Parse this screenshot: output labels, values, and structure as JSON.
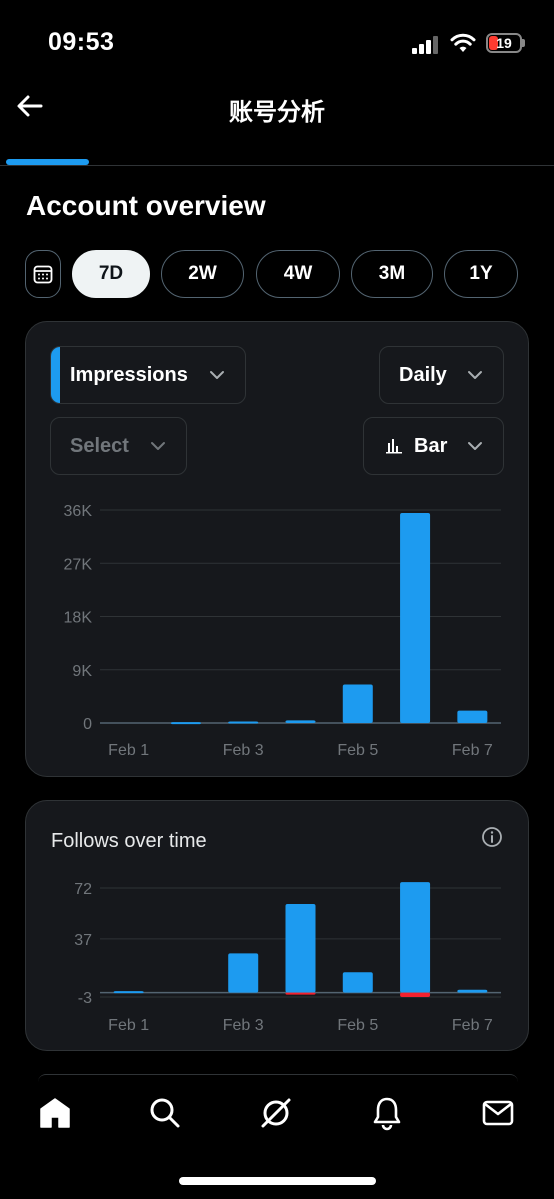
{
  "status_bar": {
    "time": "09:53",
    "battery_level": "19",
    "battery_color": "#ff3b30"
  },
  "header": {
    "title": "账号分析",
    "back_icon": "arrow-left-icon"
  },
  "overview": {
    "title": "Account overview",
    "calendar_icon": "calendar-icon",
    "ranges": [
      "7D",
      "2W",
      "4W",
      "3M",
      "1Y"
    ],
    "selected_range": "7D"
  },
  "impressions_card": {
    "metric_select": "Impressions",
    "granularity_select": "Daily",
    "compare_select_placeholder": "Select",
    "chart_type_select": "Bar",
    "accent": "#1d9bf0"
  },
  "follows_card": {
    "title": "Follows over time",
    "info_icon": "info-icon"
  },
  "bottom_nav": [
    {
      "name": "home-icon",
      "active": true
    },
    {
      "name": "search-icon",
      "active": false
    },
    {
      "name": "grok-icon",
      "active": false
    },
    {
      "name": "notifications-icon",
      "active": false
    },
    {
      "name": "messages-icon",
      "active": false
    }
  ],
  "chart_data": [
    {
      "type": "bar",
      "categories": [
        "Feb 1",
        "Feb 2",
        "Feb 3",
        "Feb 4",
        "Feb 5",
        "Feb 6",
        "Feb 7"
      ],
      "x_tick_labels": [
        "Feb 1",
        "Feb 3",
        "Feb 5",
        "Feb 7"
      ],
      "y_tick_labels": [
        "36K",
        "27K",
        "18K",
        "9K",
        "0"
      ],
      "y_ticks": [
        36000,
        27000,
        18000,
        9000,
        0
      ],
      "ylim": [
        0,
        36000
      ],
      "series": [
        {
          "values": [
            0,
            150,
            250,
            450,
            6500,
            35500,
            2100
          ],
          "color": "#1d9bf0"
        }
      ],
      "grid": true
    },
    {
      "type": "bar",
      "categories": [
        "Feb 1",
        "Feb 2",
        "Feb 3",
        "Feb 4",
        "Feb 5",
        "Feb 6",
        "Feb 7"
      ],
      "x_tick_labels": [
        "Feb 1",
        "Feb 3",
        "Feb 5",
        "Feb 7"
      ],
      "y_tick_labels": [
        "72",
        "37",
        "-3"
      ],
      "y_ticks": [
        72,
        37,
        -3
      ],
      "ylim": [
        -3,
        72
      ],
      "series": [
        {
          "values": [
            1,
            0,
            27,
            61,
            14,
            76,
            2
          ],
          "color": "#1d9bf0"
        },
        {
          "values": [
            0,
            0,
            0,
            -1,
            0,
            -3,
            0
          ],
          "color": "#f4212e"
        }
      ],
      "grid": true
    }
  ]
}
